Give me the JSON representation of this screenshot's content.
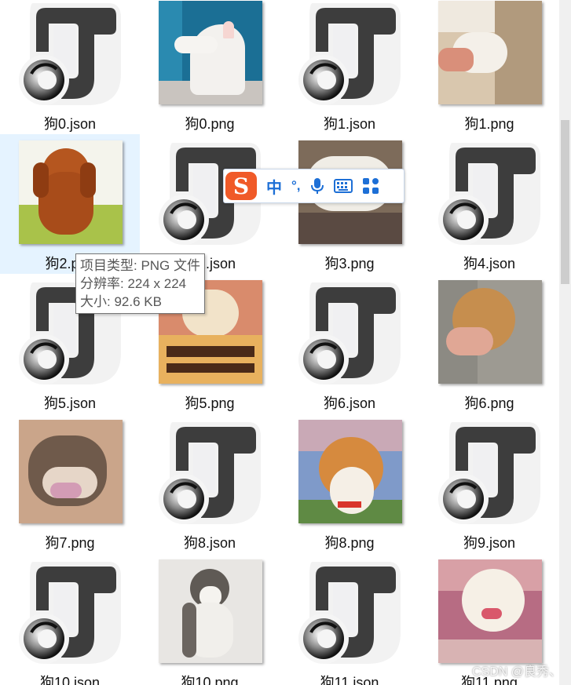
{
  "files": [
    {
      "name": "狗0.json",
      "type": "json"
    },
    {
      "name": "狗0.png",
      "type": "png",
      "photo": "white-bull-terrier"
    },
    {
      "name": "狗1.json",
      "type": "json"
    },
    {
      "name": "狗1.png",
      "type": "png",
      "photo": "puppy-in-hand"
    },
    {
      "name": "狗2.png",
      "type": "png",
      "photo": "dachshund",
      "selected": true
    },
    {
      "name": "狗2.json",
      "type": "json"
    },
    {
      "name": "狗3.png",
      "type": "png",
      "photo": "sleeping-fluffy-dog"
    },
    {
      "name": "狗4.json",
      "type": "json"
    },
    {
      "name": "狗5.json",
      "type": "json"
    },
    {
      "name": "狗5.png",
      "type": "png",
      "photo": "pomeranian-with-bread"
    },
    {
      "name": "狗6.json",
      "type": "json"
    },
    {
      "name": "狗6.png",
      "type": "png",
      "photo": "brown-dog-chin-in-hand"
    },
    {
      "name": "狗7.png",
      "type": "png",
      "photo": "puppy-sleeping-on-back"
    },
    {
      "name": "狗8.json",
      "type": "json"
    },
    {
      "name": "狗8.png",
      "type": "png",
      "photo": "shiba-inu-cherry-blossom"
    },
    {
      "name": "狗9.json",
      "type": "json"
    },
    {
      "name": "狗10.json",
      "type": "json"
    },
    {
      "name": "狗10.png",
      "type": "png",
      "photo": "husky"
    },
    {
      "name": "狗11.json",
      "type": "json"
    },
    {
      "name": "狗11.png",
      "type": "png",
      "photo": "samoyed-puppy"
    }
  ],
  "tooltip": {
    "line1": "项目类型: PNG 文件",
    "line2": "分辨率: 224 x 224",
    "line3": "大小: 92.6 KB"
  },
  "ime": {
    "logo": "S",
    "mode": "中",
    "punct": "°,",
    "icons": [
      "microphone-icon",
      "keyboard-icon",
      "apps-grid-icon"
    ]
  },
  "watermark": "CSDN @良秀、",
  "colors": {
    "json_icon_dark": "#3a3a3a",
    "selection_bg": "#e5f3ff",
    "ime_blue": "#1d6fd6",
    "ime_orange": "#f05a28"
  }
}
